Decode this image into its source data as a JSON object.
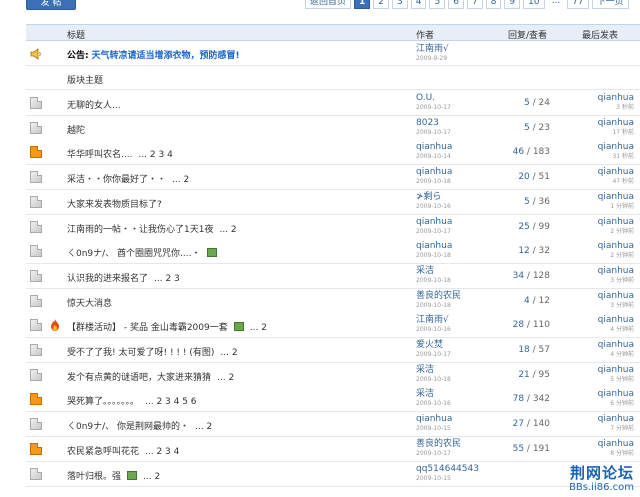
{
  "toolbar": {
    "post_label": "发 帖"
  },
  "pager": [
    "返回首页",
    "1",
    "2",
    "3",
    "4",
    "5",
    "6",
    "7",
    "8",
    "9",
    "10",
    "...",
    "77",
    "下一页"
  ],
  "header": {
    "title": "标题",
    "author": "作者",
    "stats": "回复/查看",
    "last": "最后发表"
  },
  "notice": {
    "label": "公告:",
    "text": "天气转凉请适当增添衣物，预防感冒!",
    "author": "江南雨√",
    "date": "2009-9-29"
  },
  "section_label": "版块主题",
  "rows": [
    {
      "icon": "gray",
      "title": "无聊的女人...",
      "pages": "",
      "author": "O.U.",
      "date": "2009-10-17",
      "replies": "5",
      "views": "24",
      "last": "qianhua",
      "ago": "3 秒前"
    },
    {
      "icon": "gray",
      "title": "越陀",
      "pages": "",
      "author": "8023",
      "date": "2009-10-17",
      "replies": "5",
      "views": "23",
      "last": "qianhua",
      "ago": "17 秒前"
    },
    {
      "icon": "orange",
      "title": "华华呼叫农名....",
      "pages": "... 2 3 4",
      "author": "qianhua",
      "date": "2009-10-14",
      "replies": "46",
      "views": "183",
      "last": "qianhua",
      "ago": "31 秒前"
    },
    {
      "icon": "gray",
      "title": "采洁・・你你最好了・・",
      "pages": "... 2",
      "author": "qianhua",
      "date": "2009-10-18",
      "replies": "20",
      "views": "51",
      "last": "qianhua",
      "ago": "47 秒前"
    },
    {
      "icon": "gray",
      "title": "大家来发表物质目标了?",
      "pages": "",
      "author": "≯剩ら",
      "date": "2009-10-16",
      "replies": "5",
      "views": "36",
      "last": "qianhua",
      "ago": "1 分钟前"
    },
    {
      "icon": "gray",
      "title": "江南雨的一帖・・让我伤心了1天1夜",
      "pages": "... 2",
      "author": "qianhua",
      "date": "2009-10-17",
      "replies": "25",
      "views": "99",
      "last": "qianhua",
      "ago": "2 分钟前"
    },
    {
      "icon": "gray",
      "title": "ㄑ0n9ナ/、  酋个圈圈咒咒你....・",
      "pages": "",
      "author": "qianhua",
      "date": "2009-10-18",
      "replies": "12",
      "views": "32",
      "last": "qianhua",
      "ago": "2 分钟前",
      "attach": true
    },
    {
      "icon": "gray",
      "title": "认识我的进来报名了",
      "pages": "... 2 3",
      "author": "采洁",
      "date": "2009-10-18",
      "replies": "34",
      "views": "128",
      "last": "qianhua",
      "ago": "3 分钟前"
    },
    {
      "icon": "gray",
      "title": "惊天大消息",
      "pages": "",
      "author": "善良的农民",
      "date": "2009-10-18",
      "replies": "4",
      "views": "12",
      "last": "qianhua",
      "ago": "3 分钟前"
    },
    {
      "icon": "gray",
      "title": "【群楼活动】 - 奖品 金山毒霸2009一套",
      "pages": "... 2",
      "author": "江南雨√",
      "date": "2009-10-16",
      "replies": "28",
      "views": "110",
      "last": "qianhua",
      "ago": "4 分钟前",
      "attach": true,
      "hot": true
    },
    {
      "icon": "gray",
      "title": "受不了了我! 太可爱了呀! ! ! ! (有图)",
      "pages": "... 2",
      "author": "爱火焚",
      "date": "2009-10-17",
      "replies": "18",
      "views": "57",
      "last": "qianhua",
      "ago": "4 分钟前"
    },
    {
      "icon": "gray",
      "title": "发个有点黄的谜语吧，大家进来猜猜",
      "pages": "... 2",
      "author": "采洁",
      "date": "2009-10-18",
      "replies": "21",
      "views": "95",
      "last": "qianhua",
      "ago": "5 分钟前"
    },
    {
      "icon": "orange",
      "title": "哭死算了。。。。。。。",
      "pages": "... 2 3 4 5 6",
      "author": "采洁",
      "date": "2009-10-16",
      "replies": "78",
      "views": "342",
      "last": "qianhua",
      "ago": "6 分钟前"
    },
    {
      "icon": "gray",
      "title": "ㄑ0n9ナ/、  你是荆网最帅的・",
      "pages": "... 2",
      "author": "qianhua",
      "date": "2009-10-15",
      "replies": "27",
      "views": "140",
      "last": "qianhua",
      "ago": "7 分钟前"
    },
    {
      "icon": "orange",
      "title": "农民紧急呼叫花花",
      "pages": "... 2 3 4",
      "author": "善良的农民",
      "date": "2009-10-17",
      "replies": "55",
      "views": "191",
      "last": "qianhua",
      "ago": "8 分钟前"
    },
    {
      "icon": "gray",
      "title": "落叶归根。强",
      "pages": "... 2",
      "author": "qq514644543",
      "date": "2009-10-15",
      "replies": "",
      "views": "",
      "last": "",
      "ago": "",
      "attach": true
    }
  ],
  "watermark": {
    "cn": "荆网论坛",
    "en": "BBs.ii86.com"
  },
  "colors": {
    "accent": "#3b6fb6",
    "link": "#336699",
    "notice": "#1a66cc",
    "hot_icon": "#f39a1b"
  }
}
